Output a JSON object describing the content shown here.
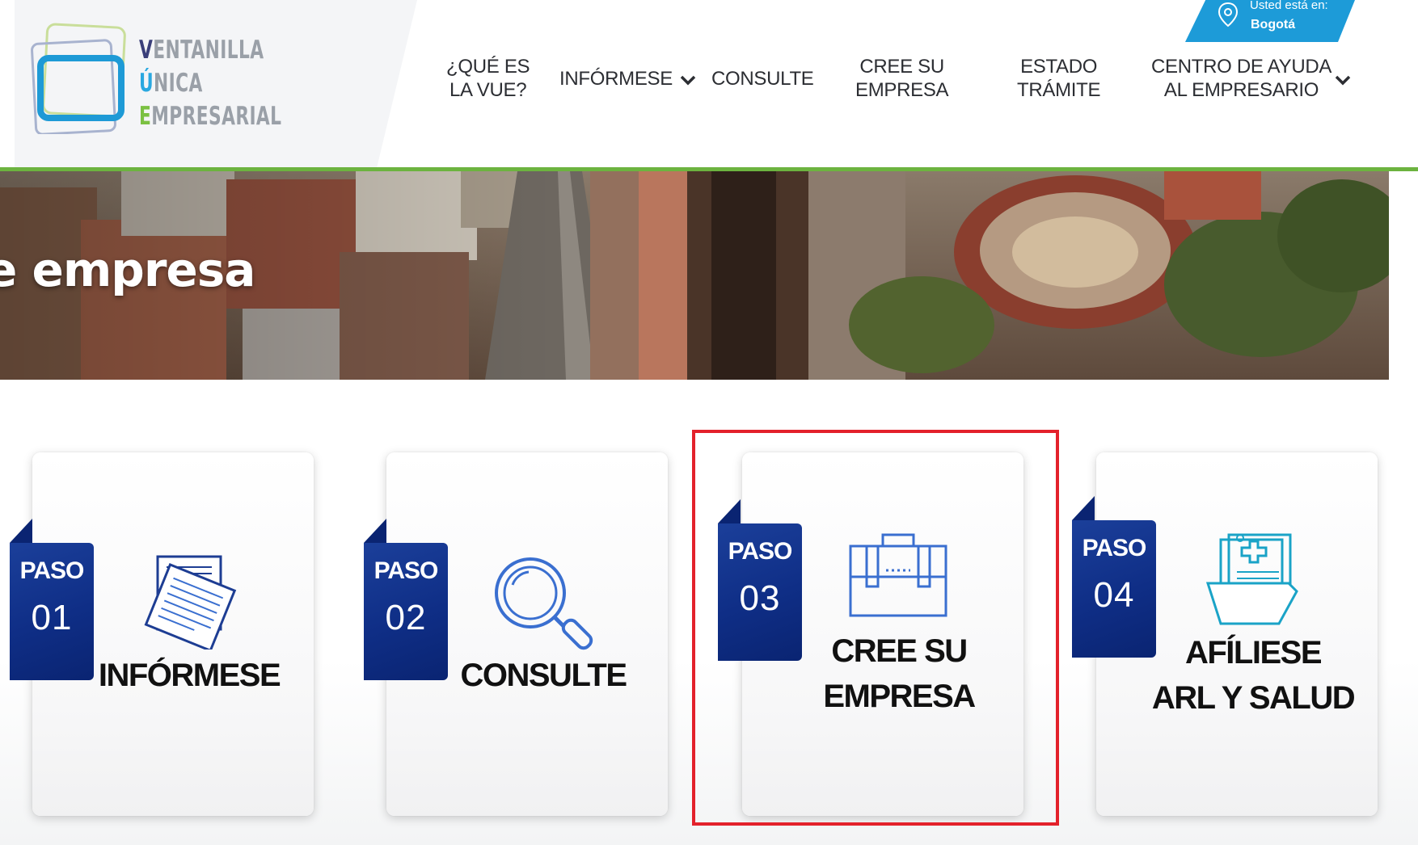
{
  "logo": {
    "line1_cap": "V",
    "line1_rest": "ENTANILLA",
    "line2_cap": "Ú",
    "line2_rest": "NICA",
    "line3_cap": "E",
    "line3_rest": "MPRESARIAL"
  },
  "nav": {
    "que_es_1": "¿QUÉ ES",
    "que_es_2": "LA VUE?",
    "informese": "INFÓRMESE",
    "consulte": "CONSULTE",
    "cree_1": "CREE SU",
    "cree_2": "EMPRESA",
    "estado_1": "ESTADO",
    "estado_2": "TRÁMITE",
    "ayuda_1": "CENTRO DE AYUDA",
    "ayuda_2": "AL EMPRESARIO"
  },
  "location": {
    "label": "Usted está en:",
    "city": "Bogotá"
  },
  "hero": {
    "title": "e empresa"
  },
  "steps": [
    {
      "paso": "PASO",
      "number": "01",
      "title_1": "INFÓRMESE",
      "title_2": "",
      "icon": "documents-icon"
    },
    {
      "paso": "PASO",
      "number": "02",
      "title_1": "CONSULTE",
      "title_2": "",
      "icon": "magnifier-icon"
    },
    {
      "paso": "PASO",
      "number": "03",
      "title_1": "CREE SU",
      "title_2": "EMPRESA",
      "icon": "briefcase-icon"
    },
    {
      "paso": "PASO",
      "number": "04",
      "title_1": "AFÍLIESE",
      "title_2": "ARL Y SALUD",
      "icon": "medical-folder-icon"
    }
  ],
  "colors": {
    "brand_blue": "#0f2e86",
    "accent_green": "#6cb33f",
    "location_blue": "#1d9bd8",
    "highlight_red": "#e3212b"
  }
}
